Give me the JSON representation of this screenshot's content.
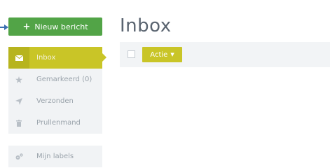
{
  "compose": {
    "icon": "plus-icon",
    "label": "Nieuw bericht"
  },
  "page": {
    "title": "Inbox"
  },
  "sidebar": {
    "items": [
      {
        "label": "Inbox",
        "icon": "envelope-icon",
        "active": true
      },
      {
        "label": "Gemarkeerd (0)",
        "icon": "star-icon",
        "active": false
      },
      {
        "label": "Verzonden",
        "icon": "send-icon",
        "active": false
      },
      {
        "label": "Prullenmand",
        "icon": "trash-icon",
        "active": false
      }
    ],
    "labels": {
      "label": "Mijn labels",
      "icon": "gears-icon"
    }
  },
  "toolbar": {
    "action_label": "Actie",
    "action_icon": "chevron-down-icon"
  },
  "colors": {
    "compose_green": "#52a447",
    "accent_yellow": "#c9c527",
    "sidebar_bg": "#f1f3f5",
    "pointer_blue": "#3a6fb0"
  }
}
